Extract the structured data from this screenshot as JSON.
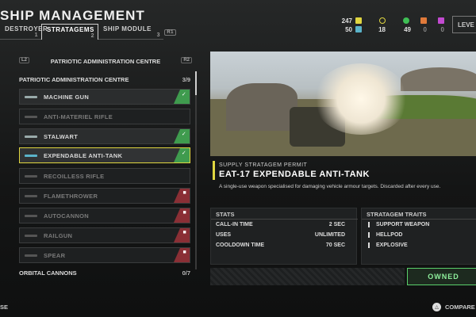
{
  "header": {
    "title": "SHIP MANAGEMENT",
    "tabs": [
      {
        "label": "DESTROYER",
        "num": "1"
      },
      {
        "label": "STRATAGEMS",
        "num": "2"
      },
      {
        "label": "SHIP MODULE",
        "num": "3"
      }
    ],
    "tab_key": "R1",
    "level_label": "LEVE"
  },
  "resources": {
    "requisition": "247",
    "medals": "50",
    "super_credits": "18",
    "samples_common": "49",
    "samples_rare": "0",
    "samples_super": "0"
  },
  "list": {
    "prev_key": "L2",
    "next_key": "R2",
    "section_title": "PATRIOTIC ADMINISTRATION CENTRE",
    "categories": [
      {
        "label": "PATRIOTIC ADMINISTRATION CENTRE",
        "count": "3/9"
      },
      {
        "label": "ORBITAL CANNONS",
        "count": "0/7"
      }
    ],
    "items": [
      {
        "label": "MACHINE GUN",
        "status": "owned"
      },
      {
        "label": "ANTI-MATERIEL RIFLE",
        "status": "locked"
      },
      {
        "label": "STALWART",
        "status": "owned"
      },
      {
        "label": "EXPENDABLE ANTI-TANK",
        "status": "owned"
      },
      {
        "label": "RECOILLESS RIFLE",
        "status": "locked"
      },
      {
        "label": "FLAMETHROWER",
        "status": "locked"
      },
      {
        "label": "AUTOCANNON",
        "status": "locked"
      },
      {
        "label": "RAILGUN",
        "status": "locked"
      },
      {
        "label": "SPEAR",
        "status": "locked"
      }
    ]
  },
  "detail": {
    "permit": "SUPPLY STRATAGEM PERMIT",
    "name": "EAT-17 EXPENDABLE ANTI-TANK",
    "description": "A single-use weapon specialised for damaging vehicle armour targets. Discarded after every use.",
    "stats_title": "STATS",
    "stats": [
      {
        "label": "CALL-IN TIME",
        "value": "2 SEC"
      },
      {
        "label": "USES",
        "value": "UNLIMITED"
      },
      {
        "label": "COOLDOWN TIME",
        "value": "70 SEC"
      }
    ],
    "traits_title": "STRATAGEM TRAITS",
    "traits": [
      "SUPPORT WEAPON",
      "HELLPOD",
      "EXPLOSIVE"
    ],
    "owned_label": "OWNED"
  },
  "footer": {
    "left_label": "SE",
    "compare_label": "COMPARE"
  },
  "colors": {
    "accent_yellow": "#e0d640",
    "owned_green": "#3f9b4e",
    "locked_red": "#8a2f35",
    "owned_button": "#5ad06b"
  }
}
